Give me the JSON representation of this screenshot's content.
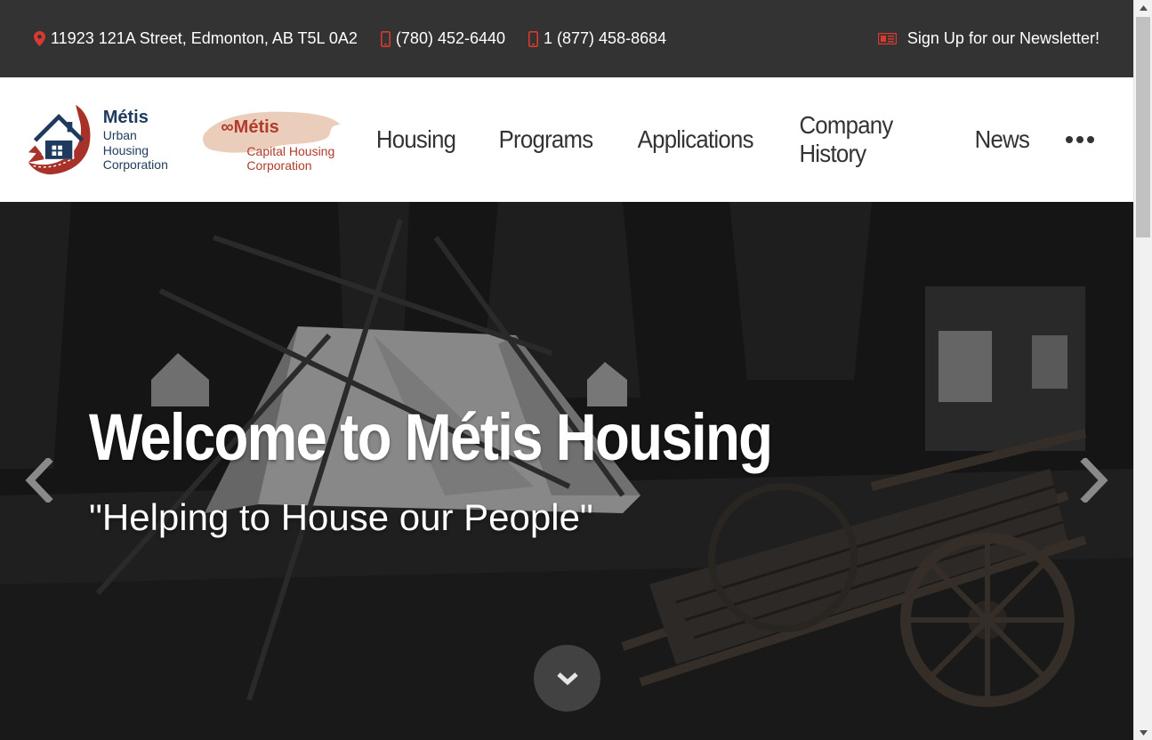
{
  "topbar": {
    "address": "11923 121A Street, Edmonton, AB T5L 0A2",
    "phone_local": "(780) 452-6440",
    "phone_tollfree": "1 (877) 458-8684",
    "newsletter_label": "Sign Up for our Newsletter!",
    "background_color": "#333333",
    "icon_color": "#d83a2f"
  },
  "logos": {
    "urban": {
      "name": "Métis",
      "line1": "Urban Housing",
      "line2": "Corporation"
    },
    "capital": {
      "name": "∞Métis",
      "line1": "Capital Housing",
      "line2": "Corporation"
    }
  },
  "nav": {
    "items": [
      {
        "label": "Housing"
      },
      {
        "label": "Programs"
      },
      {
        "label": "Applications"
      },
      {
        "label": "Company History"
      },
      {
        "label": "News"
      }
    ],
    "more_icon": "ellipsis-icon"
  },
  "hero": {
    "title": "Welcome to Métis Housing",
    "subtitle": "\"Helping to House our People\"",
    "prev_icon": "chevron-left-icon",
    "next_icon": "chevron-right-icon",
    "scroll_icon": "chevron-down-icon"
  }
}
